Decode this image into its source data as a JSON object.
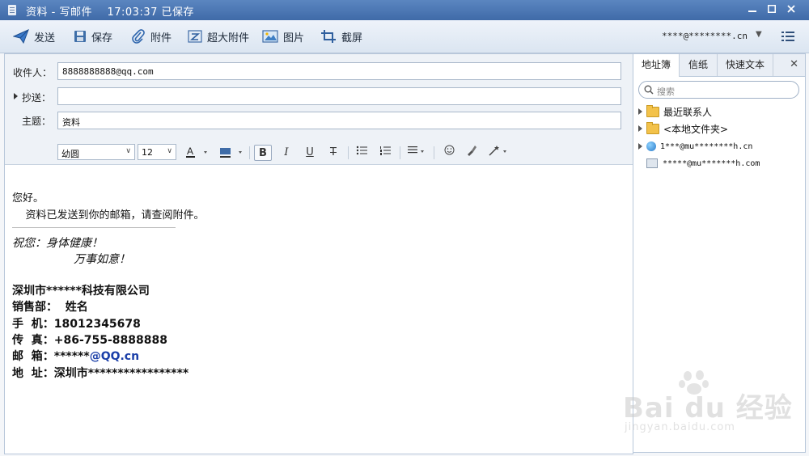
{
  "window": {
    "title": "资料 - 写邮件    17:03:37 已保存"
  },
  "toolbar": {
    "send": "发送",
    "save": "保存",
    "attach": "附件",
    "big_attach": "超大附件",
    "picture": "图片",
    "screenshot": "截屏",
    "account": "****@********.cn"
  },
  "fields": {
    "to_label": "收件人：",
    "to_value": "8888888888@qq.com",
    "cc_label": "抄送：",
    "cc_value": "",
    "subject_label": "主题：",
    "subject_value": "资料"
  },
  "format": {
    "font": "幼圆",
    "size": "12"
  },
  "body": {
    "greeting": "您好。",
    "line1": "    资料已发送到你的邮箱，请查阅附件。",
    "wish1": "祝您：身体健康！",
    "wish2": "万事如意！",
    "company": "深圳市******科技有限公司",
    "dept": "销售部：  姓名",
    "mobile": "手  机：18012345678",
    "fax": "传  真：+86-755-8888888",
    "email_label": "邮  箱：******",
    "email_domain": "@QQ.cn",
    "address": "地  址：深圳市*****************"
  },
  "panel": {
    "tab_contacts": "地址簿",
    "tab_stationery": "信纸",
    "tab_quicktext": "快速文本",
    "search_placeholder": "搜索",
    "recent": "最近联系人",
    "local": "<本地文件夹>",
    "contact1": "1***@mu********h.cn",
    "contact2": "*****@mu*******h.com"
  },
  "watermark": {
    "brand": "Bai du 经验",
    "url": "jingyan.baidu.com"
  }
}
